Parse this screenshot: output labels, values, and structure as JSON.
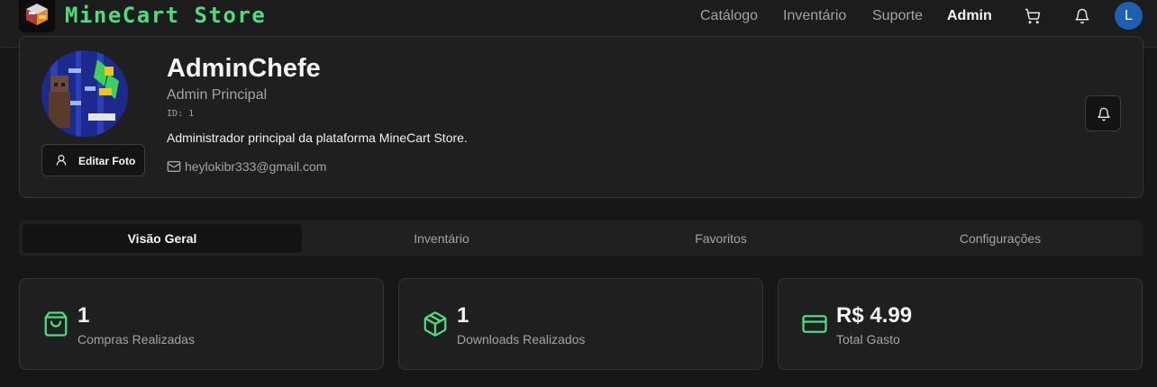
{
  "header": {
    "brand": "MineCart Store",
    "nav": [
      "Catálogo",
      "Inventário",
      "Suporte",
      "Admin"
    ],
    "active_nav": "Admin",
    "icons": [
      "shopping-cart-icon",
      "bell-icon"
    ],
    "user_initial": "L",
    "accent_color": "#4ade80",
    "avatar_color": "#1d5fb0"
  },
  "profile": {
    "name": "AdminChefe",
    "role": "Admin Principal",
    "id_label": "ID: 1",
    "description": "Administrador principal da plataforma MineCart Store.",
    "email": "heylokibr333@gmail.com",
    "edit_photo_label": "Editar Foto"
  },
  "tabs": {
    "items": [
      "Visão Geral",
      "Inventário",
      "Favoritos",
      "Configurações"
    ],
    "active": "Visão Geral"
  },
  "stats": [
    {
      "icon": "shopping-bag-icon",
      "value": "1",
      "label": "Compras Realizadas"
    },
    {
      "icon": "package-icon",
      "value": "1",
      "label": "Downloads Realizados"
    },
    {
      "icon": "credit-card-icon",
      "value": "R$ 4.99",
      "label": "Total Gasto"
    }
  ]
}
